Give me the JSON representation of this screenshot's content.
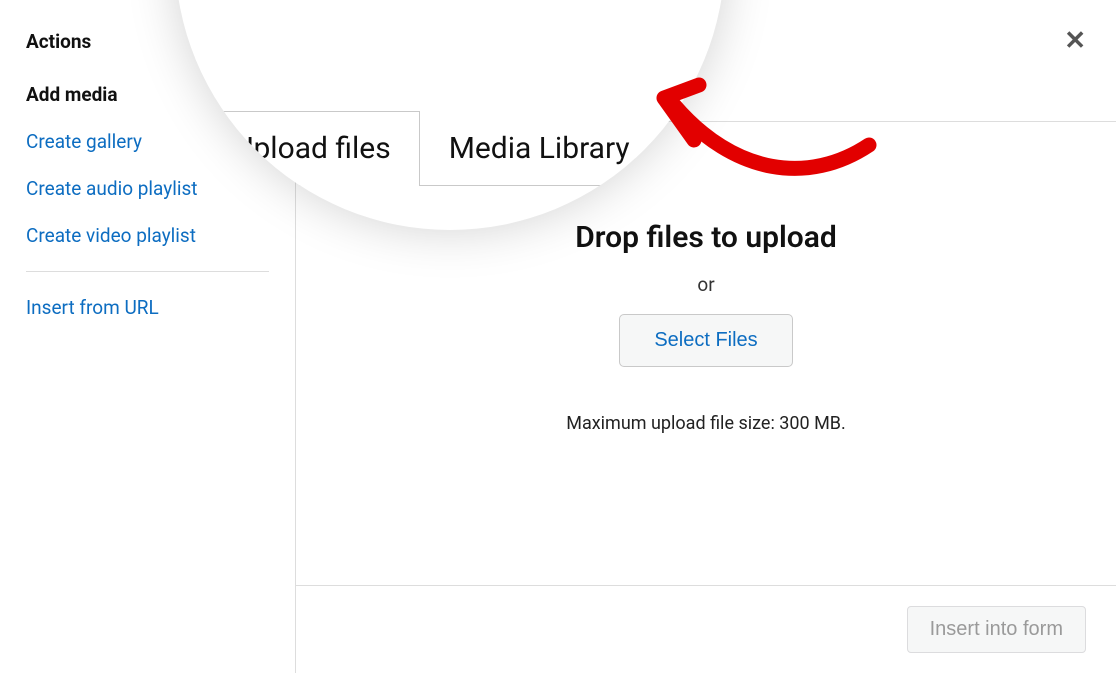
{
  "sidebar": {
    "heading_actions": "Actions",
    "heading_add_media": "Add media",
    "link_gallery": "Create gallery",
    "link_audio": "Create audio playlist",
    "link_video": "Create video playlist",
    "link_url": "Insert from URL"
  },
  "tabs": {
    "upload_files": "Upload files",
    "media_library": "Media Library"
  },
  "drop": {
    "title": "Drop files to upload",
    "or": "or",
    "select_btn": "Select Files",
    "max_size": "Maximum upload file size: 300 MB."
  },
  "footer": {
    "insert_btn": "Insert into form"
  },
  "close_icon": "✕"
}
